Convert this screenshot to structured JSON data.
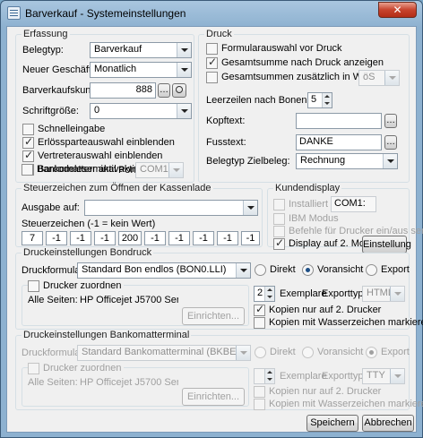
{
  "window": {
    "title": "Barverkauf - Systemeinstellungen",
    "close_label": "✕"
  },
  "erfassung": {
    "legend": "Erfassung",
    "belegtyp_label": "Belegtyp:",
    "belegtyp_value": "Barverkauf",
    "geschaeftsfall_label": "Neuer Geschäftsfall:",
    "geschaeftsfall_value": "Monatlich",
    "barverkaufskunde_label": "Barverkaufskunde:",
    "barverkaufskunde_value": "888",
    "schriftgroesse_label": "Schriftgröße:",
    "schriftgroesse_value": "0",
    "checkboxes": [
      {
        "label": "Schnelleingabe",
        "checked": false
      },
      {
        "label": "Erlössparteauswahl einblenden",
        "checked": true
      },
      {
        "label": "Vertreterauswahl einblenden",
        "checked": true
      },
      {
        "label": "Barcodeleser aktiv",
        "checked": true
      }
    ],
    "bankomat_label": "Bankomatterminal aktiv",
    "port_label": "Port:",
    "port_value": "COM1:"
  },
  "druck": {
    "legend": "Druck",
    "formularauswahl_label": "Formularauswahl vor Druck",
    "gesamtsumme_label": "Gesamtsumme nach Druck anzeigen",
    "gesamtsummen_waehrung_label": "Gesamtsummen zusätzlich in Währung:",
    "waehrung_value": "öS",
    "leerzeilen_label": "Leerzeilen nach Bonende:",
    "leerzeilen_value": "5",
    "kopftext_label": "Kopftext:",
    "kopftext_value": "",
    "fusstext_label": "Fusstext:",
    "fusstext_value": "DANKE",
    "zielbeleg_label": "Belegtyp Zielbeleg:",
    "zielbeleg_value": "Rechnung"
  },
  "steuerzeichen": {
    "legend": "Steuerzeichen zum Öffnen der Kassenlade",
    "ausgabe_label": "Ausgabe auf:",
    "ausgabe_value": "",
    "codes_label": "Steuerzeichen (-1 = kein Wert)",
    "codes": [
      "7",
      "-1",
      "-1",
      "-1",
      "200",
      "-1",
      "-1",
      "-1",
      "-1",
      "-1"
    ]
  },
  "kundendisplay": {
    "legend": "Kundendisplay",
    "installiert_label": "Installiert an:",
    "installiert_value": "COM1:",
    "ibm_label": "IBM Modus",
    "befehle_label": "Befehle für Drucker ein/aus senden",
    "monitor_label": "Display auf 2. Monitor",
    "einstellung_label": "Einstellung"
  },
  "bondruck": {
    "legend": "Druckeinstellungen Bondruck",
    "druckformular_label": "Druckformular:",
    "druckformular_value": "Standard Bon endlos (BON0.LLI)",
    "radio_direkt": "Direkt",
    "radio_voransicht": "Voransicht",
    "radio_export": "Export",
    "drucker_zuordnen_label": "Drucker zuordnen",
    "alle_seiten_label": "Alle Seiten:",
    "alle_seiten_value": "HP Officejet J5700 Series (USB0",
    "einrichten_label": "Einrichten...",
    "exemplare_value": "2",
    "exemplare_label": "Exemplare",
    "exporttyp_label": "Exporttyp:",
    "exporttyp_value": "HTML",
    "kopien_2_drucker_label": "Kopien nur auf 2. Drucker",
    "kopien_wasserzeichen_label": "Kopien mit Wasserzeichen markieren"
  },
  "bankomat": {
    "legend": "Druckeinstellungen Bankomatterminal",
    "druckformular_label": "Druckformular:",
    "druckformular_value": "Standard Bankomatterminal (BKBELEG0.LLI)",
    "radio_direkt": "Direkt",
    "radio_voransicht": "Voransicht",
    "radio_export": "Export",
    "drucker_zuordnen_label": "Drucker zuordnen",
    "alle_seiten_label": "Alle Seiten:",
    "alle_seiten_value": "HP Officejet J5700 Series (USB0",
    "einrichten_label": "Einrichten...",
    "exemplare_label": "Exemplare",
    "exporttyp_label": "Exporttyp:",
    "exporttyp_value": "TTY",
    "kopien_2_drucker_label": "Kopien nur auf 2. Drucker",
    "kopien_wasserzeichen_label": "Kopien mit Wasserzeichen markieren"
  },
  "footer": {
    "speichern_label": "Speichern",
    "abbrechen_label": "Abbrechen"
  }
}
